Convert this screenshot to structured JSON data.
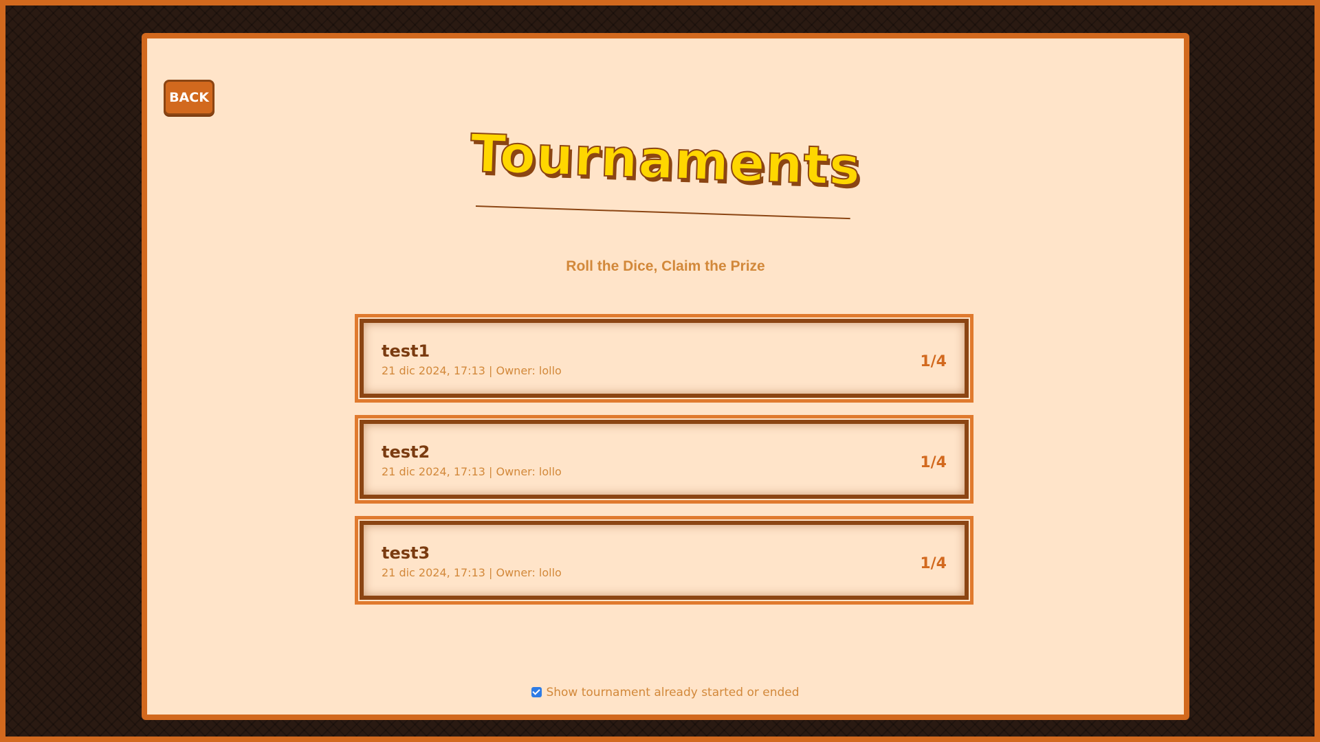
{
  "header": {
    "back_label": "BACK",
    "title": "Tournaments",
    "subtitle": "Roll the Dice, Claim the Prize"
  },
  "tournaments": [
    {
      "name": "test1",
      "meta": "21 dic 2024, 17:13 | Owner: lollo",
      "players": "1/4"
    },
    {
      "name": "test2",
      "meta": "21 dic 2024, 17:13 | Owner: lollo",
      "players": "1/4"
    },
    {
      "name": "test3",
      "meta": "21 dic 2024, 17:13 | Owner: lollo",
      "players": "1/4"
    }
  ],
  "filter": {
    "label": "Show tournament already started or ended",
    "checked": true
  },
  "colors": {
    "accent": "#d2691e",
    "dark_brown": "#8b4513",
    "panel_bg": "#ffe4c9",
    "title_yellow": "#ffd700",
    "checkbox_blue": "#2d7be5"
  }
}
